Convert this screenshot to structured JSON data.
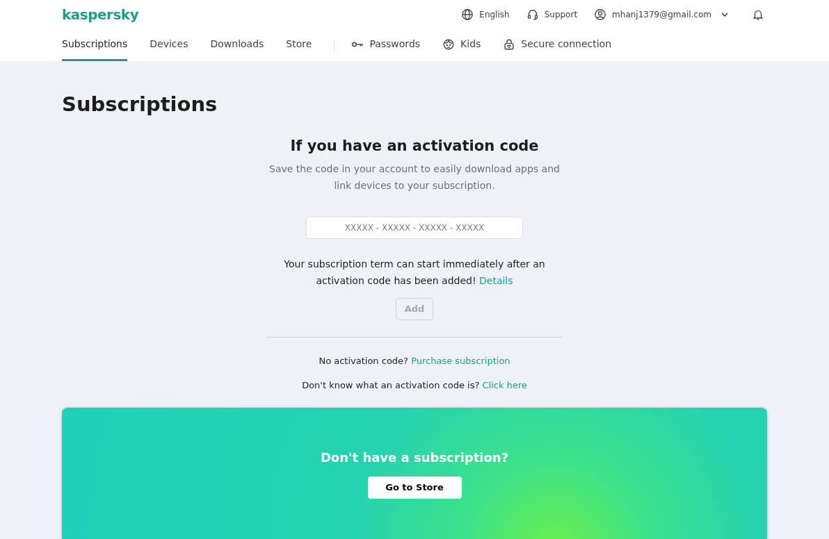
{
  "header": {
    "logo": "kaspersky",
    "language": "English",
    "support": "Support",
    "account": "mhanj1379@gmail.com"
  },
  "nav": [
    {
      "label": "Subscriptions",
      "selected": true,
      "kind": "plain"
    },
    {
      "label": "Devices",
      "selected": false,
      "kind": "plain"
    },
    {
      "label": "Downloads",
      "selected": false,
      "kind": "plain"
    },
    {
      "label": "Store",
      "selected": false,
      "kind": "plain"
    },
    {
      "label": "Passwords",
      "selected": false,
      "kind": "key"
    },
    {
      "label": "Kids",
      "selected": false,
      "kind": "kids"
    },
    {
      "label": "Secure connection",
      "selected": false,
      "kind": "lock"
    }
  ],
  "page_title": "Subscriptions",
  "activation": {
    "heading": "If you have an activation code",
    "description": "Save the code in your account to easily download apps and link devices to your subscription.",
    "code_field": {
      "placeholder": "XXXXX - XXXXX - XXXXX - XXXXX"
    },
    "note": "Your subscription term can start immediately after an activation code has been added!",
    "note_link": "Details",
    "add_button": {
      "label": "Add",
      "disabled": true
    },
    "no_code": "No activation code?",
    "no_code_link": "Purchase subscription",
    "unknown": "Don't know what an activation code is?",
    "unknown_link": "Click here"
  },
  "banner": {
    "heading": "Don't have a subscription?",
    "button": "Go to Store"
  }
}
